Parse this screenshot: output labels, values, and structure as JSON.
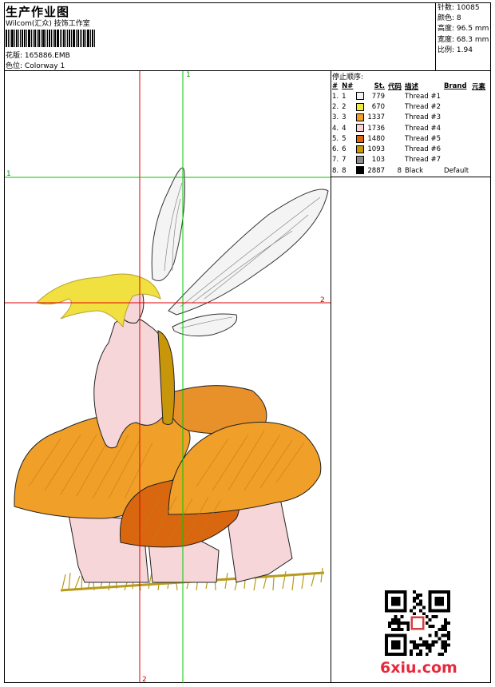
{
  "header": {
    "title": "生产作业图",
    "studio": "Wilcom(汇众) 技饰工作室",
    "design_label": "花版:",
    "design_value": "165886.EMB",
    "colorway_label": "色位:",
    "colorway_value": "Colorway 1"
  },
  "stats": [
    {
      "label": "针数:",
      "value": "10085"
    },
    {
      "label": "颜色:",
      "value": "8"
    },
    {
      "label": "高度:",
      "value": "96.5 mm"
    },
    {
      "label": "宽度:",
      "value": "68.3 mm"
    },
    {
      "label": "比例:",
      "value": "1.94"
    }
  ],
  "color_sequence": {
    "title": "停止顺序:",
    "columns": [
      "#",
      "N#",
      "St.",
      "代码",
      "描述",
      "Brand",
      "元素"
    ],
    "rows": [
      {
        "num": "1.",
        "n": "1",
        "color": "#f2f2f2",
        "st": "779",
        "code": "",
        "desc": "Thread #1",
        "brand": ""
      },
      {
        "num": "2.",
        "n": "2",
        "color": "#f0ec3a",
        "st": "670",
        "code": "",
        "desc": "Thread #2",
        "brand": ""
      },
      {
        "num": "3.",
        "n": "3",
        "color": "#f0a028",
        "st": "1337",
        "code": "",
        "desc": "Thread #3",
        "brand": ""
      },
      {
        "num": "4.",
        "n": "4",
        "color": "#f8d2d8",
        "st": "1736",
        "code": "",
        "desc": "Thread #4",
        "brand": ""
      },
      {
        "num": "5.",
        "n": "5",
        "color": "#d9670f",
        "st": "1480",
        "code": "",
        "desc": "Thread #5",
        "brand": ""
      },
      {
        "num": "6.",
        "n": "6",
        "color": "#c8960a",
        "st": "1093",
        "code": "",
        "desc": "Thread #6",
        "brand": ""
      },
      {
        "num": "7.",
        "n": "7",
        "color": "#8a8a8a",
        "st": "103",
        "code": "",
        "desc": "Thread #7",
        "brand": ""
      },
      {
        "num": "8.",
        "n": "8",
        "color": "#000000",
        "st": "2887",
        "code": "8",
        "desc": "Black",
        "brand": "Default"
      }
    ]
  },
  "markers": {
    "green_top": "1",
    "green_left": "1",
    "red_right": "2",
    "red_bottom": "2"
  },
  "watermark": {
    "text": "6xiu.com"
  },
  "colors": {
    "guide_green": "#00c800",
    "guide_red": "#e00000"
  }
}
